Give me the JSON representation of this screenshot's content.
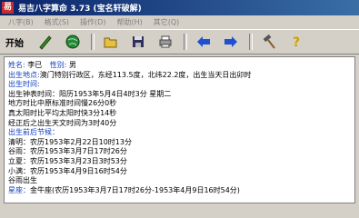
{
  "app": {
    "title": "易吉八字算命  3.73 (宝名轩破解)",
    "icon_char": "易"
  },
  "menu": [
    "八字(B)",
    "格式(S)",
    "操作(D)",
    "帮助(H)",
    "其它(Q)"
  ],
  "toolbar": {
    "start_label": "开始"
  },
  "content": {
    "lines": [
      {
        "label": "姓名:",
        "text": "李已",
        "label2": "性别:",
        "text2": "男"
      },
      {
        "label": "出生地点:",
        "text": "澳门特别行政区，东经113.5度，北纬22.2度，出生当天日出卯时"
      },
      {
        "label": "出生时间:",
        "text": ""
      },
      {
        "label": "",
        "text": "出生钟表时间：阳历1953年5月4日4时3分 星期二"
      },
      {
        "label": "",
        "text": "地方时比中原标准时间慢26分0秒"
      },
      {
        "label": "",
        "text": "真太阳时比平均太阳时快3分14秒"
      },
      {
        "label": "",
        "text": "经正后之出生天文时间为3时40分"
      },
      {
        "label": "出生前后节候：",
        "text": ""
      },
      {
        "label": "",
        "text": "清明：农历1953年2月22日10时13分"
      },
      {
        "label": "",
        "text": "谷雨：农历1953年3月7日17时26分"
      },
      {
        "label": "",
        "text": "立夏：农历1953年3月23日3时53分"
      },
      {
        "label": "",
        "text": "小满：农历1953年4月9日16时54分"
      },
      {
        "label": "",
        "text": "谷雨出生"
      },
      {
        "label": "星座：",
        "text": "金牛座(农历1953年3月7日17时26分-1953年4月9日16时54分)"
      }
    ]
  }
}
